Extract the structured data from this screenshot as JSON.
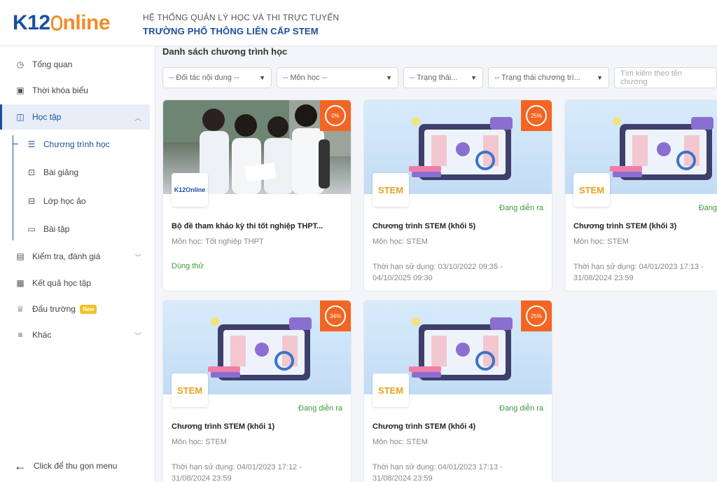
{
  "header": {
    "logo_k12": "K12",
    "logo_online": "nline",
    "school_line1": "HỆ THỐNG QUẢN LÝ HỌC VÀ THI TRỰC TUYẾN",
    "school_line2": "TRƯỜNG PHỔ THÔNG LIÊN CẤP STEM"
  },
  "sidebar": {
    "items": [
      {
        "label": "Tổng quan",
        "icon": "dashboard-icon"
      },
      {
        "label": "Thời khóa biểu",
        "icon": "calendar-icon"
      },
      {
        "label": "Học tập",
        "icon": "book-icon"
      },
      {
        "label": "Chương trình học",
        "icon": "list-icon"
      },
      {
        "label": "Bài giảng",
        "icon": "open-book-icon"
      },
      {
        "label": "Lớp học ảo",
        "icon": "virtual-class-icon"
      },
      {
        "label": "Bài tập",
        "icon": "tablet-icon"
      },
      {
        "label": "Kiểm tra, đánh giá",
        "icon": "clipboard-icon"
      },
      {
        "label": "Kết quả học tập",
        "icon": "result-icon"
      },
      {
        "label": "Đấu trường",
        "icon": "trophy-icon"
      },
      {
        "label": "Khác",
        "icon": "menu-icon"
      }
    ],
    "new_badge": "New",
    "collapse_label": "Click để thu gọn menu"
  },
  "main": {
    "title": "Danh sách chương trình học",
    "filters": [
      "-- Đối tác nội dung --",
      "-- Môn học --",
      "-- Trạng thái...",
      "-- Trạng thái chương trì..."
    ],
    "search_placeholder": "Tìm kiếm theo tên chương",
    "cards": [
      {
        "percent": "0%",
        "status": "",
        "title": "Bộ đề tham khảo kỳ thi tốt nghiệp THPT...",
        "subject": "Môn học: Tốt nghiệp THPT",
        "trial": "Dùng thử",
        "expiry1": "",
        "expiry2": "",
        "logo": "K12Online"
      },
      {
        "percent": "25%",
        "status": "Đang diễn ra",
        "title": "Chương trình STEM (khối 5)",
        "subject": "Môn học: STEM",
        "expiry1": "Thời hạn sử dụng: 03/10/2022 09:35 -",
        "expiry2": "04/10/2025 09:30",
        "logo": "STEM"
      },
      {
        "percent": "",
        "status": "Đang",
        "title": "Chương trình STEM (khối 3)",
        "subject": "Môn học: STEM",
        "expiry1": "Thời hạn sử dụng: 04/01/2023 17:13 -",
        "expiry2": "31/08/2024 23:59",
        "logo": "STEM"
      },
      {
        "percent": "34%",
        "status": "Đang diễn ra",
        "title": "Chương trình STEM (khối 1)",
        "subject": "Môn học: STEM",
        "expiry1": "Thời hạn sử dụng: 04/01/2023 17:12 -",
        "expiry2": "31/08/2024 23:59",
        "logo": "STEM"
      },
      {
        "percent": "25%",
        "status": "Đang diễn ra",
        "title": "Chương trình STEM (khối 4)",
        "subject": "Môn học: STEM",
        "expiry1": "Thời hạn sử dụng: 04/01/2023 17:13 -",
        "expiry2": "31/08/2024 23:59",
        "logo": "STEM"
      }
    ]
  },
  "colors": {
    "brand_blue": "#1b4fa0",
    "brand_orange": "#f28c28",
    "status_green": "#3d9a3d",
    "percent_badge": "#f26522"
  }
}
